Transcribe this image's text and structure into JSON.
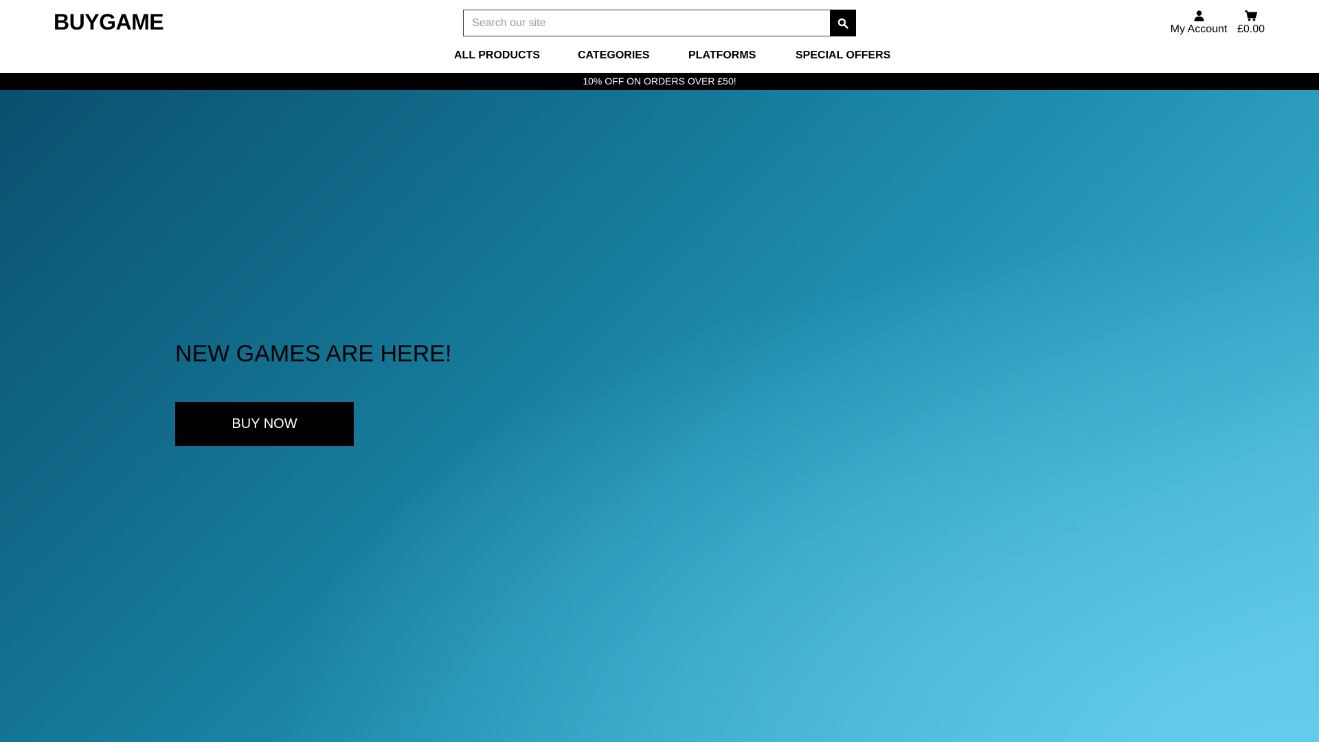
{
  "header": {
    "logo": "BUYGAME",
    "search": {
      "placeholder": "Search our site",
      "value": "",
      "button_icon": "search-icon"
    },
    "account": {
      "icon": "user-icon",
      "label": "My Account"
    },
    "cart": {
      "icon": "cart-icon",
      "total": "£0.00"
    }
  },
  "nav": {
    "items": [
      {
        "label": "ALL PRODUCTS"
      },
      {
        "label": "CATEGORIES"
      },
      {
        "label": "PLATFORMS"
      },
      {
        "label": "SPECIAL OFFERS"
      }
    ]
  },
  "promo": {
    "text": "10% OFF ON ORDERS OVER £50!"
  },
  "hero": {
    "title": "NEW GAMES ARE HERE!",
    "button_label": "BUY NOW"
  },
  "colors": {
    "header_bg": "#ffffff",
    "promo_bg": "#000000",
    "hero_gradient_start": "#0a4f70",
    "hero_gradient_end": "#5bc6e3",
    "button_bg": "#000000"
  }
}
